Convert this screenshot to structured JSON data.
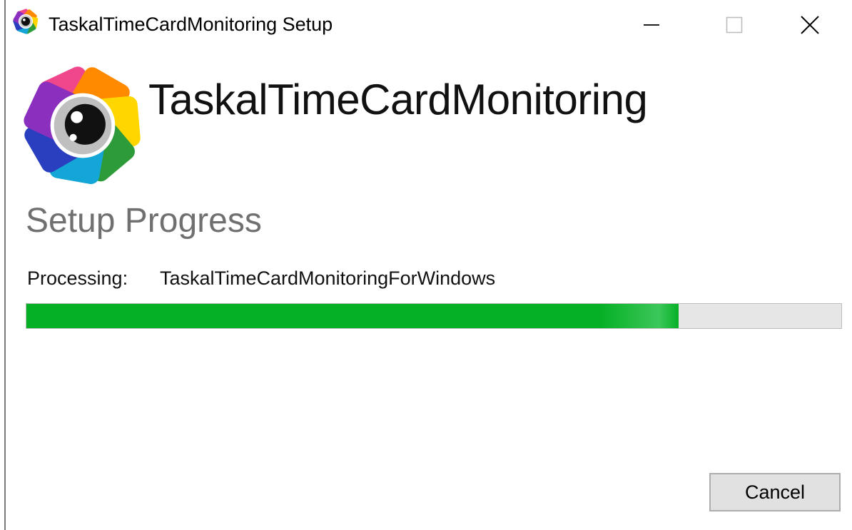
{
  "window": {
    "title": "TaskalTimeCardMonitoring Setup"
  },
  "title_bar": {
    "icons": {
      "app": "app-logo-icon",
      "minimize": "minimize-icon",
      "maximize": "maximize-icon",
      "close": "close-icon"
    }
  },
  "header": {
    "product_name": "TaskalTimeCardMonitoring",
    "logo_icon": "app-logo-icon"
  },
  "progress": {
    "section_title": "Setup Progress",
    "processing_label": "Processing:",
    "processing_item": "TaskalTimeCardMonitoringForWindows",
    "fraction": 0.8
  },
  "buttons": {
    "cancel_label": "Cancel"
  },
  "colors": {
    "progress_fill": "#06b025",
    "progress_track": "#e6e6e6",
    "section_title": "#707070"
  }
}
